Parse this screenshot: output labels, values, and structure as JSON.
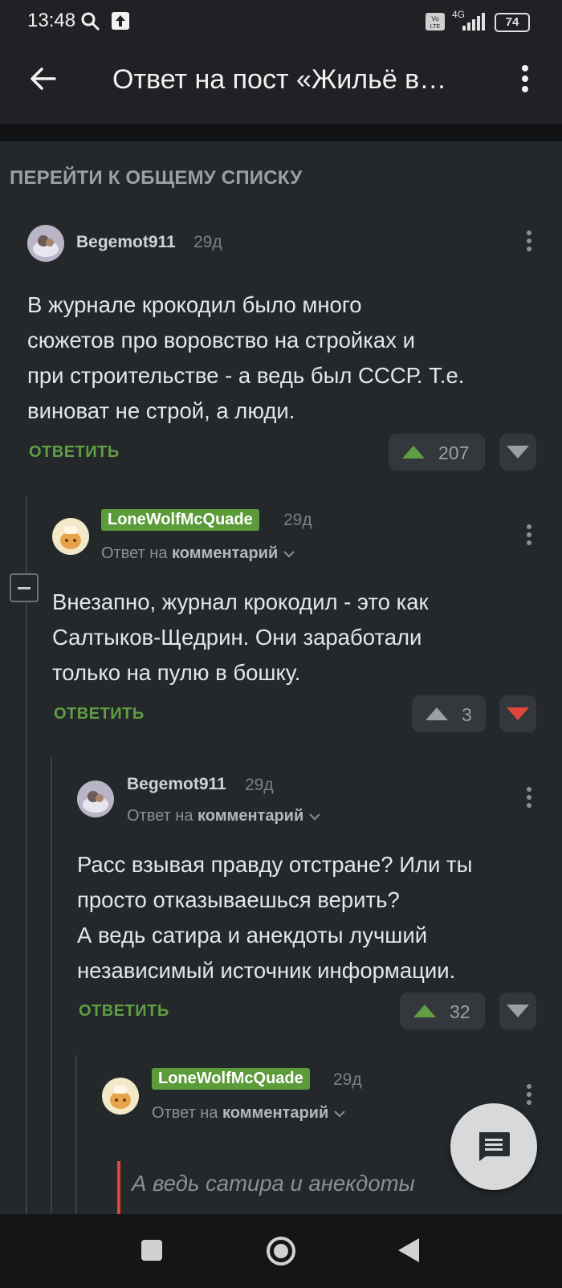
{
  "status_bar": {
    "time": "13:48",
    "battery": "74",
    "network": "4G"
  },
  "header": {
    "title": "Ответ на пост «Жильё в…"
  },
  "goto_all_label": "ПЕРЕЙТИ К ОБЩЕМУ СПИСКУ",
  "comments": [
    {
      "author": "Begemot911",
      "age": "29д",
      "text_lines": [
        "В журнале крокодил было много",
        "сюжетов про воровство на стройках и",
        "при строительстве - а ведь был СССР. Т.е.",
        "виноват не строй, а люди."
      ],
      "reply_label": "ОТВЕТИТЬ",
      "rating": "207"
    },
    {
      "author": "LoneWolfMcQuade",
      "age": "29д",
      "reply_to_prefix": "Ответ на",
      "reply_to_target": "комментарий",
      "text_lines": [
        "Внезапно, журнал крокодил - это как",
        "Салтыков-Щедрин. Они заработали",
        "только на пулю в бошку."
      ],
      "reply_label": "ОТВЕТИТЬ",
      "rating": "3"
    },
    {
      "author": "Begemot911",
      "age": "29д",
      "reply_to_prefix": "Ответ на",
      "reply_to_target": "комментарий",
      "text_lines": [
        "Расс взывая правду отстране? Или ты",
        "просто отказываешься верить?",
        "А ведь сатира и анекдоты лучший",
        "независимый источник информации."
      ],
      "reply_label": "ОТВЕТИТЬ",
      "rating": "32"
    },
    {
      "author": "LoneWolfMcQuade",
      "age": "29д",
      "reply_to_prefix": "Ответ на",
      "reply_to_target": "комментарий",
      "quote": "А ведь сатира и анекдоты"
    }
  ],
  "colors": {
    "accent_green": "#5f9e43",
    "downvote_red": "#e0453a",
    "background": "#25282b"
  }
}
